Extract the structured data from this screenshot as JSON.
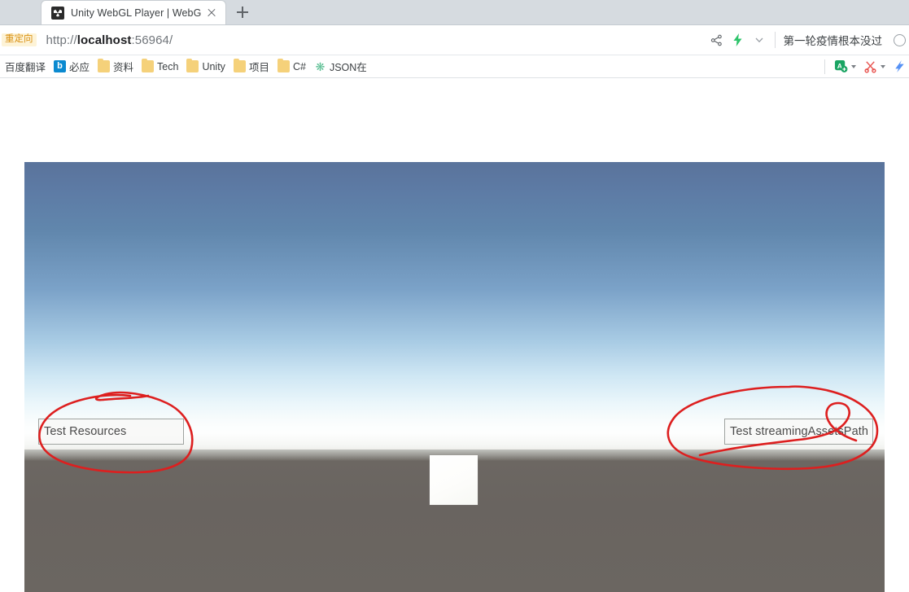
{
  "browser": {
    "tab": {
      "title": "Unity WebGL Player | WebGL_",
      "favicon": "unity-logo-icon",
      "close_icon": "close-icon"
    },
    "new_tab_icon": "plus-icon",
    "address_bar": {
      "redirect_badge": "重定向",
      "url_scheme": "http://",
      "url_host": "localhost",
      "url_rest": ":56964/"
    },
    "omnibar_icons": [
      {
        "name": "share-icon",
        "glyph": "share"
      },
      {
        "name": "lightning-icon",
        "glyph": "lightning",
        "color": "#2ec46b"
      },
      {
        "name": "chevron-down-icon",
        "glyph": "chevron-down"
      }
    ],
    "omnibar_note": "第一轮疫情根本没过",
    "omnibar_search_icon": "search-icon",
    "bookmarks": [
      {
        "label": "百度翻译",
        "icon": "none"
      },
      {
        "label": "必应",
        "icon": "bing-icon"
      },
      {
        "label": "资料",
        "icon": "folder-icon"
      },
      {
        "label": "Tech",
        "icon": "folder-icon"
      },
      {
        "label": "Unity",
        "icon": "folder-icon"
      },
      {
        "label": "项目",
        "icon": "folder-icon"
      },
      {
        "label": "C#",
        "icon": "folder-icon"
      },
      {
        "label": "JSON在",
        "icon": "json-extension-icon"
      }
    ],
    "extensions": [
      {
        "name": "translate-extension-icon",
        "color": "#1aa463"
      },
      {
        "name": "screenshot-scissors-icon",
        "color": "#e8534f"
      },
      {
        "name": "partial-extension-icon",
        "color": "#4285f4"
      }
    ]
  },
  "unity": {
    "buttons": [
      {
        "label": "Test Resources",
        "name": "test-resources-button"
      },
      {
        "label": "Test streamingAssetsPath",
        "name": "test-streaming-assets-path-button"
      }
    ],
    "scene": {
      "cube_label": "white-cube",
      "sky_top_color": "#5a739b",
      "sky_horizon_color": "#f6fbfb",
      "ground_color": "#6a6560"
    },
    "annotations": [
      {
        "name": "red-circle-left",
        "color": "#dd1f1f",
        "targets": "Test Resources"
      },
      {
        "name": "red-circle-right",
        "color": "#dd1f1f",
        "targets": "Test streamingAssetsPath"
      }
    ]
  }
}
